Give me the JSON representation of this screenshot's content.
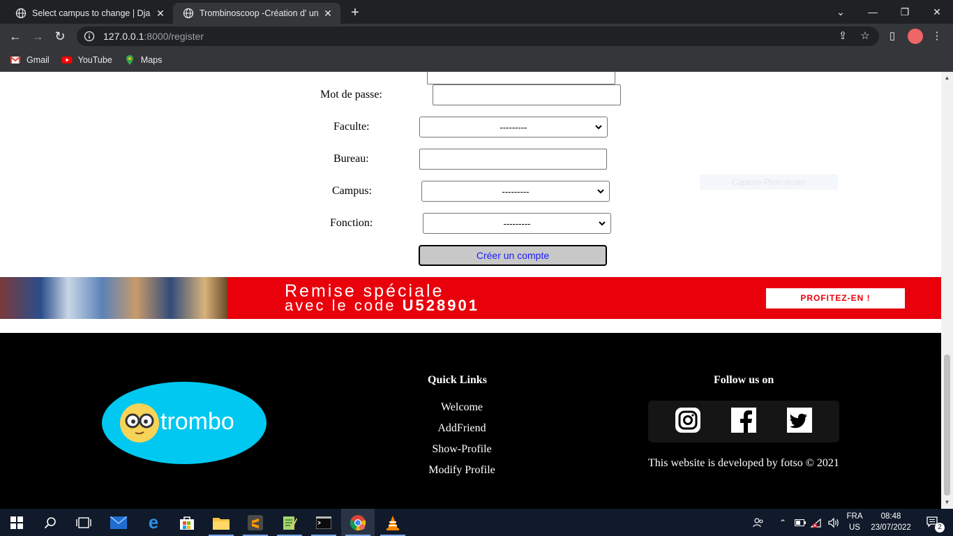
{
  "browser": {
    "tabs": [
      {
        "title": "Select campus to change | Django",
        "active": false
      },
      {
        "title": "Trombinoscoop -Création d' un profil",
        "active": true
      }
    ],
    "url": {
      "host": "127.0.0.1",
      "rest": ":8000/register"
    },
    "bookmarks": [
      {
        "label": "Gmail",
        "icon": "gmail-icon"
      },
      {
        "label": "YouTube",
        "icon": "youtube-icon"
      },
      {
        "label": "Maps",
        "icon": "maps-icon"
      }
    ]
  },
  "form": {
    "password_label": "Mot de passe:",
    "faculty_label": "Faculte:",
    "faculty_value": "---------",
    "office_label": "Bureau:",
    "campus_label": "Campus:",
    "campus_value": "---------",
    "function_label": "Fonction:",
    "function_value": "---------",
    "submit_label": "Créer un compte",
    "ghost_text": "Capture Plein écran"
  },
  "banner": {
    "line1": "Remise spéciale",
    "line2_prefix": "avec le code ",
    "code": "U528901",
    "cta": "PROFITEZ-EN !"
  },
  "footer": {
    "logo_text": "trombo",
    "quick_links_title": "Quick Links",
    "links": [
      "Welcome",
      "AddFriend",
      "Show-Profile",
      "Modify Profile"
    ],
    "follow_title": "Follow us on",
    "social": [
      "instagram-icon",
      "facebook-icon",
      "twitter-icon"
    ],
    "credit": "This website is developed by fotso © 2021"
  },
  "taskbar": {
    "lang_top": "FRA",
    "lang_bottom": "US",
    "time": "08:48",
    "date": "23/07/2022",
    "notifications": "2"
  },
  "colors": {
    "banner_red": "#e8000b",
    "logo_blue": "#00c8f0",
    "footer_bg": "#000000",
    "submit_text": "#1a1aff"
  }
}
